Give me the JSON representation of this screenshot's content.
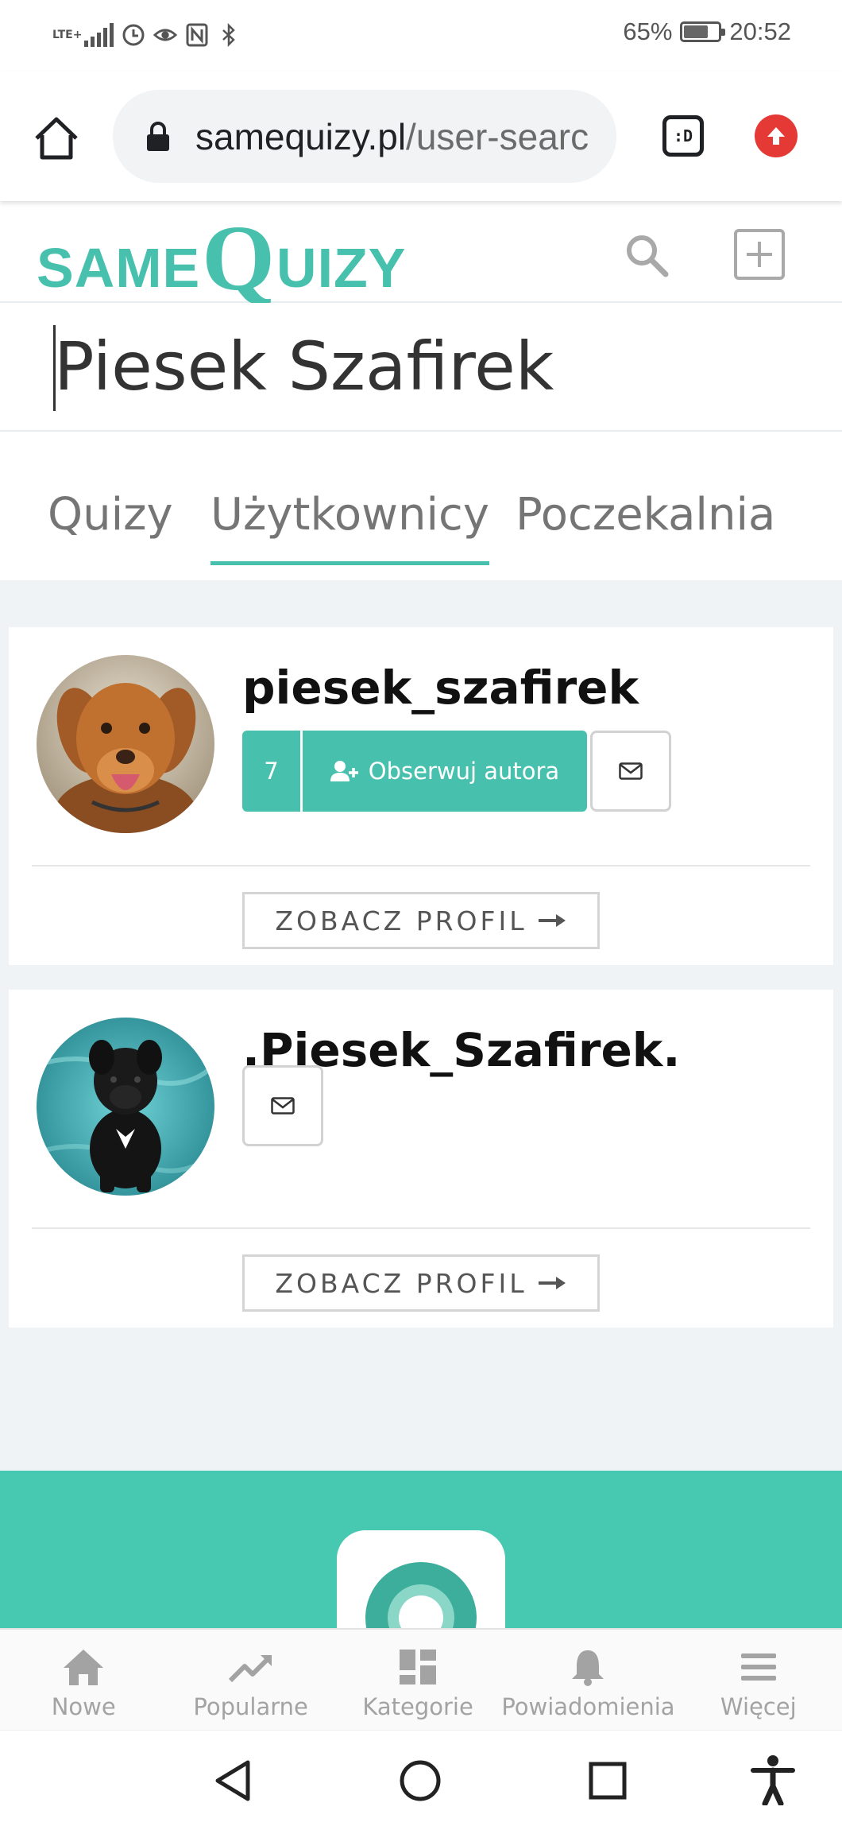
{
  "status_bar": {
    "network": "LTE+",
    "battery": "65%",
    "time": "20:52"
  },
  "browser": {
    "url_host": "samequizy.pl",
    "url_path": "/user-searc",
    "tabs_label": ":D"
  },
  "header": {
    "logo_same": "SAME",
    "logo_q": "Q",
    "logo_uizy": "UIZY"
  },
  "search": {
    "value": "Piesek Szafirek"
  },
  "tabs": [
    {
      "label": "Quizy"
    },
    {
      "label": "Użytkownicy"
    },
    {
      "label": "Poczekalnia"
    }
  ],
  "results": [
    {
      "username": "piesek_szafirek",
      "followers": "7",
      "follow_label": "Obserwuj autora",
      "profile_label": "ZOBACZ PROFIL"
    },
    {
      "username": ".Piesek_Szafirek.",
      "profile_label": "ZOBACZ PROFIL"
    }
  ],
  "bottom_nav": [
    {
      "label": "Nowe",
      "icon": "home-icon"
    },
    {
      "label": "Popularne",
      "icon": "trending-icon"
    },
    {
      "label": "Kategorie",
      "icon": "dashboard-icon"
    },
    {
      "label": "Powiadomienia",
      "icon": "bell-icon"
    },
    {
      "label": "Więcej",
      "icon": "menu-icon"
    }
  ],
  "colors": {
    "accent": "#47c1ad",
    "danger": "#e53935"
  }
}
